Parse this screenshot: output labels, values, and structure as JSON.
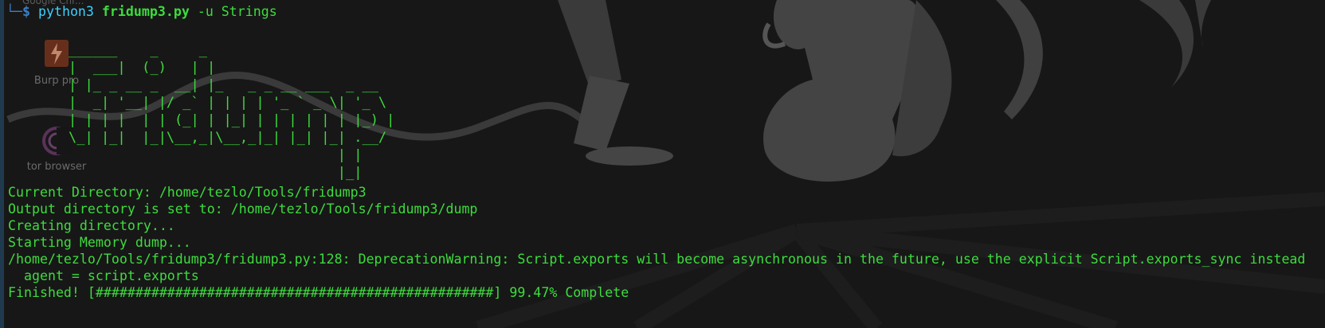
{
  "desktop": {
    "icons": [
      {
        "label": "Burp pro",
        "icon": "burp-suite-icon"
      },
      {
        "label": "tor browser",
        "icon": "tor-browser-icon"
      }
    ],
    "partial_top_label": "Google Chr..."
  },
  "terminal": {
    "prompt_symbol": "$",
    "command": {
      "program": "python3",
      "script": "fridump3.py",
      "args": "-u Strings"
    },
    "ascii_banner": "______    _     _\n|  ___|  (_)   | |\n| |_ _ __ _  __| |_   _ _ __ ___  _ __\n|  _| '__| |/ _` | | | | '_ ` _ \\| '_ \\\n| | | |  | | (_| | |_| | | | | | | |_) |\n\\_| |_|  |_|\\__,_|\\__,_|_| |_| |_| .__/\n                                 | |\n                                 |_|",
    "output_lines": [
      "Current Directory: /home/tezlo/Tools/fridump3",
      "Output directory is set to: /home/tezlo/Tools/fridump3/dump",
      "Creating directory...",
      "Starting Memory dump...",
      "/home/tezlo/Tools/fridump3/fridump3.py:128: DeprecationWarning: Script.exports will become asynchronous in the future, use the explicit Script.exports_sync instead",
      "  agent = script.exports",
      "Finished! [##################################################] 99.47% Complete"
    ]
  },
  "colors": {
    "background": "#161616",
    "terminal_text": "#3ddc3d",
    "prompt": "#3b7fc4",
    "python_keyword": "#3dd0ff"
  }
}
